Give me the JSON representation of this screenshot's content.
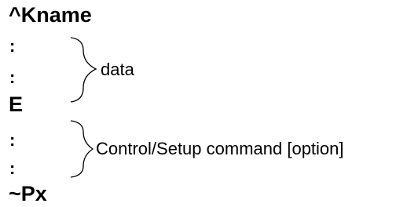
{
  "lines": {
    "start": "^Kname",
    "dot1": ":",
    "dot2": ":",
    "end_data": "E",
    "dot3": ":",
    "dot4": ":",
    "end": "~Px"
  },
  "braces": {
    "data_label": "data",
    "command_label": "Control/Setup command [option]"
  }
}
